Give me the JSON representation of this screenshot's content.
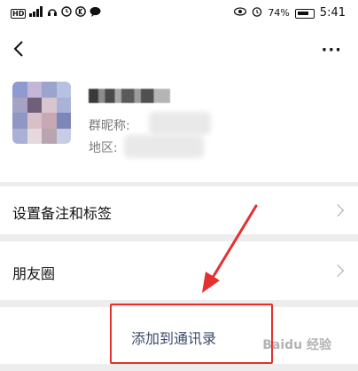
{
  "status_bar": {
    "left_icons": [
      "hd-badge",
      "4g-signal-icon",
      "wifi-signal-icon",
      "headset-icon",
      "clock-icon",
      "k-app-icon",
      "chat-icon"
    ],
    "hd_label": "HD",
    "battery_percent": "74%",
    "time": "5:41"
  },
  "navbar": {
    "back_icon": "back-chevron-icon",
    "more_label": "···"
  },
  "profile": {
    "group_nickname_label": "群昵称:",
    "region_label": "地区:"
  },
  "cells": [
    {
      "label": "设置备注和标签"
    },
    {
      "label": "朋友圈"
    }
  ],
  "add_button": {
    "label": "添加到通讯录"
  },
  "colors": {
    "highlight_box": "#e53030",
    "link_text": "#3b4a6b",
    "page_bg": "#ededed"
  }
}
